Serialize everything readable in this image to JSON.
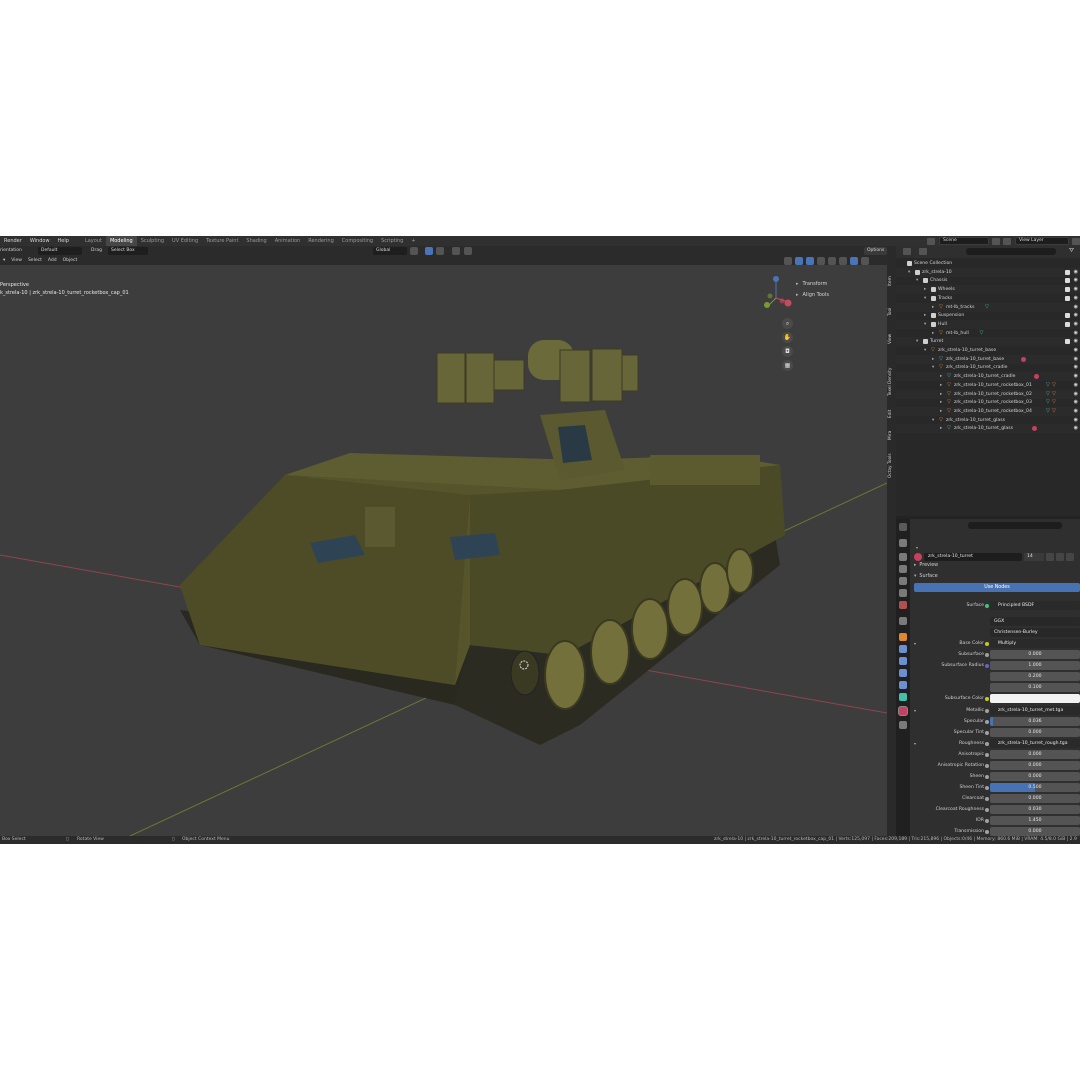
{
  "menu": [
    "Render",
    "Window",
    "Help"
  ],
  "workspaces": [
    {
      "label": "Layout",
      "active": false
    },
    {
      "label": "Modeling",
      "active": true
    },
    {
      "label": "Sculpting",
      "active": false
    },
    {
      "label": "UV Editing",
      "active": false
    },
    {
      "label": "Texture Paint",
      "active": false
    },
    {
      "label": "Shading",
      "active": false
    },
    {
      "label": "Animation",
      "active": false
    },
    {
      "label": "Rendering",
      "active": false
    },
    {
      "label": "Compositing",
      "active": false
    },
    {
      "label": "Scripting",
      "active": false
    }
  ],
  "add_workspace": "+",
  "topbar": {
    "scene": "Scene",
    "view_layer": "View Layer"
  },
  "viewport": {
    "orientation_label": "rientation",
    "orientation_value": "Default",
    "drag_label": "Drag",
    "drag_value": "Select Box",
    "menu": [
      "View",
      "Select",
      "Add",
      "Object"
    ],
    "transform_space": "Global",
    "options": "Options",
    "view_name": "Perspective",
    "object_path": "k_strela-10 | zrk_strela-10_turret_rocketbox_cap_01",
    "sidebar_items": [
      "Transform",
      "Align Tools"
    ],
    "gizmo": {
      "x": "X",
      "y": "Y",
      "z": "Z"
    }
  },
  "vertical_tabs": [
    "Item",
    "Tool",
    "View",
    "Texel Density",
    "Edit",
    "Mira",
    "Octay Tools"
  ],
  "outliner": {
    "search_placeholder": "",
    "rows": [
      {
        "label": "Scene Collection",
        "depth": 0,
        "kind": "collection",
        "expand": ""
      },
      {
        "label": "zrk_strela-10",
        "depth": 1,
        "kind": "collection",
        "expand": "▾",
        "check": true
      },
      {
        "label": "Chassis",
        "depth": 2,
        "kind": "collection",
        "expand": "▾",
        "check": true
      },
      {
        "label": "Wheels",
        "depth": 3,
        "kind": "collection",
        "expand": "▸",
        "check": true,
        "extra": "∇₁₂"
      },
      {
        "label": "Tracks",
        "depth": 3,
        "kind": "collection",
        "expand": "▾",
        "check": true
      },
      {
        "label": "mt-lb_tracks",
        "depth": 4,
        "kind": "object",
        "expand": "▸"
      },
      {
        "label": "Suspension",
        "depth": 3,
        "kind": "collection",
        "expand": "▸",
        "check": true,
        "extra": "∇₁₂"
      },
      {
        "label": "Hull",
        "depth": 3,
        "kind": "collection",
        "expand": "▾",
        "check": true
      },
      {
        "label": "mt-lb_hull",
        "depth": 4,
        "kind": "object",
        "expand": "▸"
      },
      {
        "label": "Turret",
        "depth": 2,
        "kind": "collection",
        "expand": "▾",
        "check": true
      },
      {
        "label": "zrk_strela-10_turret_base",
        "depth": 3,
        "kind": "object",
        "expand": "▾"
      },
      {
        "label": "zrk_strela-10_turret_base",
        "depth": 4,
        "kind": "mesh",
        "expand": "▸"
      },
      {
        "label": "zrk_strela-10_turret_cradle",
        "depth": 4,
        "kind": "object",
        "expand": "▾"
      },
      {
        "label": "zrk_strela-10_turret_cradle",
        "depth": 5,
        "kind": "mesh",
        "expand": "▸"
      },
      {
        "label": "zrk_strela-10_turret_rocketbox_01",
        "depth": 5,
        "kind": "object",
        "expand": "▸"
      },
      {
        "label": "zrk_strela-10_turret_rocketbox_02",
        "depth": 5,
        "kind": "object",
        "expand": "▸"
      },
      {
        "label": "zrk_strela-10_turret_rocketbox_03",
        "depth": 5,
        "kind": "object",
        "expand": "▸"
      },
      {
        "label": "zrk_strela-10_turret_rocketbox_04",
        "depth": 5,
        "kind": "object",
        "expand": "▸"
      },
      {
        "label": "zrk_strela-10_turret_glass",
        "depth": 4,
        "kind": "object",
        "expand": "▾"
      },
      {
        "label": "zrk_strela-10_turret_glass",
        "depth": 5,
        "kind": "mesh",
        "expand": "▸"
      }
    ]
  },
  "properties": {
    "material_name": "zrk_strela-10_turret",
    "material_users": "14",
    "panel_preview": "Preview",
    "panel_surface": "Surface",
    "use_nodes": "Use Nodes",
    "rows": [
      {
        "label": "Surface",
        "value": "Principled BSDF",
        "kind": "link",
        "socket": "#3fc47a"
      },
      {
        "label": "",
        "value": "GGX",
        "kind": "dd"
      },
      {
        "label": "",
        "value": "Christensen-Burley",
        "kind": "dd"
      },
      {
        "label": "Base Color",
        "value": "Multiply",
        "kind": "link",
        "socket": "#c7c729",
        "expand": "▾"
      },
      {
        "label": "Subsurface",
        "value": "0.000",
        "kind": "num",
        "socket": "#a1a1a1"
      },
      {
        "label": "Subsurface Radius",
        "value": "1.000",
        "kind": "num",
        "socket": "#6363c7"
      },
      {
        "label": "",
        "value": "0.200",
        "kind": "num"
      },
      {
        "label": "",
        "value": "0.100",
        "kind": "num"
      },
      {
        "label": "Subsurface Color",
        "value": "",
        "kind": "white",
        "socket": "#c7c729"
      },
      {
        "label": "Metallic",
        "value": "zrk_strela-10_turret_met.tga",
        "kind": "link",
        "socket": "#a1a1a1",
        "expand": "▾"
      },
      {
        "label": "Specular",
        "value": "0.036",
        "kind": "num",
        "socket": "#a1a1a1",
        "fill": 0.036
      },
      {
        "label": "Specular Tint",
        "value": "0.000",
        "kind": "num",
        "socket": "#a1a1a1"
      },
      {
        "label": "Roughness",
        "value": "zrk_strela-10_turret_rough.tga",
        "kind": "link",
        "socket": "#a1a1a1",
        "expand": "▾"
      },
      {
        "label": "Anisotropic",
        "value": "0.000",
        "kind": "num",
        "socket": "#a1a1a1"
      },
      {
        "label": "Anisotropic Rotation",
        "value": "0.000",
        "kind": "num",
        "socket": "#a1a1a1"
      },
      {
        "label": "Sheen",
        "value": "0.000",
        "kind": "num",
        "socket": "#a1a1a1"
      },
      {
        "label": "Sheen Tint",
        "value": "0.500",
        "kind": "num",
        "socket": "#a1a1a1",
        "fill": 0.5
      },
      {
        "label": "Clearcoat",
        "value": "0.000",
        "kind": "num",
        "socket": "#a1a1a1"
      },
      {
        "label": "Clearcoat Roughness",
        "value": "0.030",
        "kind": "num",
        "socket": "#a1a1a1"
      },
      {
        "label": "IOR",
        "value": "1.450",
        "kind": "num",
        "socket": "#a1a1a1"
      },
      {
        "label": "Transmission",
        "value": "0.000",
        "kind": "num",
        "socket": "#a1a1a1"
      }
    ]
  },
  "statusbar": {
    "left1": "Box Select",
    "left2": "Rotate View",
    "left3": "Object Context Menu",
    "right": "zrk_strela-10 | zrk_strela-10_turret_rocketbox_cap_01 | Verts:125,097 | Faces:209,189 | Tris:215,896 | Objects:0/46 | Memory: 860.6 MiB | VRAM: 4.5/8.0 GiB | 2.9"
  },
  "colors": {
    "accent": "#4772b3",
    "tank": "#55542a",
    "x_axis": "#c64b5e",
    "y_axis": "#7a9a30"
  }
}
